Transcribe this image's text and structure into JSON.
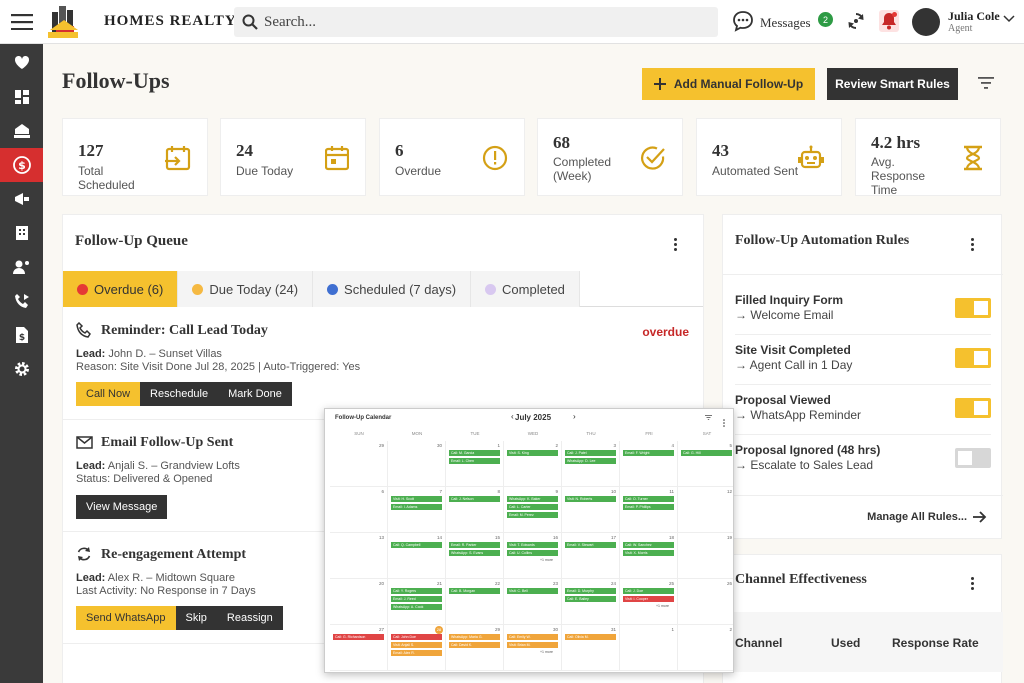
{
  "app": {
    "brand": "HOMES REALTY"
  },
  "search": {
    "placeholder": "Search..."
  },
  "header": {
    "messages_label": "Messages",
    "messages_count": "2",
    "user_name": "Julia Cole",
    "user_role": "Agent"
  },
  "page": {
    "title": "Follow-Ups",
    "add_label": "Add Manual Follow-Up",
    "review_label": "Review Smart Rules"
  },
  "stats": [
    {
      "value": "127",
      "label": "Total Scheduled",
      "icon": "calendar-arrow-icon"
    },
    {
      "value": "24",
      "label": "Due Today",
      "icon": "calendar-icon"
    },
    {
      "value": "6",
      "label": "Overdue",
      "icon": "alert-circle-icon"
    },
    {
      "value": "68",
      "label": "Completed (Week)",
      "icon": "check-circle-icon"
    },
    {
      "value": "43",
      "label": "Automated Sent",
      "icon": "robot-icon"
    },
    {
      "value": "4.2 hrs",
      "label": "Avg. Response Time",
      "icon": "hourglass-icon"
    }
  ],
  "queue": {
    "title": "Follow-Up Queue",
    "tabs": [
      {
        "label": "Overdue (6)",
        "color": "#e53935"
      },
      {
        "label": "Due Today (24)",
        "color": "#f5b942"
      },
      {
        "label": "Scheduled (7 days)",
        "color": "#3f6fd1"
      },
      {
        "label": "Completed",
        "color": "#d8c8f0"
      }
    ],
    "items": [
      {
        "title": "Reminder: Call Lead Today",
        "status": "overdue",
        "line1_key": "Lead:",
        "line1": "John D. – Sunset Villas",
        "line2": "Reason: Site Visit Done Jul 28, 2025 | Auto-Triggered: Yes",
        "buttons": [
          "Call Now",
          "Reschedule",
          "Mark Done"
        ]
      },
      {
        "title": "Email Follow-Up Sent",
        "line1_key": "Lead:",
        "line1": "Anjali S. – Grandview Lofts",
        "line2": "Status: Delivered & Opened",
        "buttons": [
          "View Message"
        ]
      },
      {
        "title": "Re-engagement Attempt",
        "line1_key": "Lead:",
        "line1": "Alex R. – Midtown Square",
        "line2": "Last Activity: No Response in 7 Days",
        "buttons": [
          "Send WhatsApp",
          "Skip",
          "Reassign"
        ]
      }
    ]
  },
  "rules": {
    "title": "Follow-Up Automation Rules",
    "items": [
      {
        "trigger": "Filled Inquiry Form",
        "action": "→ Welcome Email",
        "on": true
      },
      {
        "trigger": "Site Visit Completed",
        "action": "→ Agent Call in 1 Day",
        "on": true
      },
      {
        "trigger": "Proposal Viewed",
        "action": "→ WhatsApp Reminder",
        "on": true
      },
      {
        "trigger": "Proposal Ignored (48 hrs)",
        "action": "→ Escalate to Sales Lead",
        "on": false
      }
    ],
    "manage_label": "Manage All Rules..."
  },
  "channel": {
    "title": "Channel Effectiveness",
    "cols": [
      "Channel",
      "Used",
      "Response Rate"
    ]
  },
  "calendar": {
    "title": "Follow-Up Calendar",
    "month": "July 2025",
    "dows": [
      "SUN",
      "MON",
      "TUE",
      "WED",
      "THU",
      "FRI",
      "SAT"
    ],
    "weeks": [
      [
        {
          "d": "29",
          "ev": []
        },
        {
          "d": "30",
          "ev": []
        },
        {
          "d": "1",
          "ev": [
            [
              "g",
              "Call: M. Garcia"
            ],
            [
              "g",
              "Email: L. Chen"
            ]
          ]
        },
        {
          "d": "2",
          "ev": [
            [
              "g",
              "Visit: S. King"
            ]
          ]
        },
        {
          "d": "3",
          "ev": [
            [
              "g",
              "Call: J. Patel"
            ],
            [
              "g",
              "WhatsApp: D. Lee"
            ]
          ]
        },
        {
          "d": "4",
          "ev": [
            [
              "g",
              "Email: F. Wright"
            ]
          ]
        },
        {
          "d": "5",
          "ev": [
            [
              "g",
              "Call: G. Hill"
            ]
          ]
        }
      ],
      [
        {
          "d": "6",
          "ev": []
        },
        {
          "d": "7",
          "ev": [
            [
              "g",
              "Visit: H. Scott"
            ],
            [
              "g",
              "Email: I. Adams"
            ]
          ]
        },
        {
          "d": "8",
          "ev": [
            [
              "g",
              "Call: J. Nelson"
            ]
          ]
        },
        {
          "d": "9",
          "ev": [
            [
              "g",
              "WhatsApp: K. Baker"
            ],
            [
              "g",
              "Call: L. Carter"
            ],
            [
              "g",
              "Email: M. Perez"
            ]
          ]
        },
        {
          "d": "10",
          "ev": [
            [
              "g",
              "Visit: N. Roberts"
            ]
          ]
        },
        {
          "d": "11",
          "ev": [
            [
              "g",
              "Call: O. Turner"
            ],
            [
              "g",
              "Email: P. Phillips"
            ]
          ]
        },
        {
          "d": "12",
          "ev": []
        }
      ],
      [
        {
          "d": "13",
          "ev": []
        },
        {
          "d": "14",
          "ev": [
            [
              "g",
              "Call: Q. Campbell"
            ]
          ]
        },
        {
          "d": "15",
          "ev": [
            [
              "g",
              "Email: R. Parker"
            ],
            [
              "g",
              "WhatsApp: S. Evans"
            ]
          ]
        },
        {
          "d": "16",
          "ev": [
            [
              "g",
              "Visit: T. Edwards"
            ],
            [
              "g",
              "Call: U. Collins"
            ]
          ],
          "more": "+1 more"
        },
        {
          "d": "17",
          "ev": [
            [
              "g",
              "Email: V. Stewart"
            ]
          ]
        },
        {
          "d": "18",
          "ev": [
            [
              "g",
              "Call: W. Sanchez"
            ],
            [
              "g",
              "Visit: X. Morris"
            ]
          ]
        },
        {
          "d": "19",
          "ev": []
        }
      ],
      [
        {
          "d": "20",
          "ev": []
        },
        {
          "d": "21",
          "ev": [
            [
              "g",
              "Call: Y. Rogers"
            ],
            [
              "g",
              "Email: J. Reed"
            ],
            [
              "g",
              "WhatsApp: A. Cook"
            ]
          ]
        },
        {
          "d": "22",
          "ev": [
            [
              "g",
              "Call: B. Morgan"
            ]
          ]
        },
        {
          "d": "23",
          "ev": [
            [
              "g",
              "Visit: C. Bell"
            ]
          ]
        },
        {
          "d": "24",
          "ev": [
            [
              "g",
              "Email: D. Murphy"
            ],
            [
              "g",
              "Call: E. Bailey"
            ]
          ]
        },
        {
          "d": "25",
          "ev": [
            [
              "g",
              "Call: J. Doe"
            ],
            [
              "r",
              "Visit: I. Cooper"
            ]
          ],
          "more": "+1 more"
        },
        {
          "d": "26",
          "ev": []
        }
      ],
      [
        {
          "d": "27",
          "ev": [
            [
              "r",
              "Call: G. Richardson"
            ]
          ]
        },
        {
          "d": "28",
          "today": true,
          "ev": [
            [
              "r",
              "Call: John Doe"
            ],
            [
              "o",
              "Visit: Anjali S."
            ],
            [
              "o",
              "Email: Alex R."
            ]
          ]
        },
        {
          "d": "29",
          "ev": [
            [
              "o",
              "WhatsApp: Maria G."
            ],
            [
              "o",
              "Call: David K."
            ]
          ]
        },
        {
          "d": "30",
          "ev": [
            [
              "o",
              "Call: Emily W."
            ],
            [
              "o",
              "Visit: Brian M."
            ]
          ],
          "more": "+1 more"
        },
        {
          "d": "31",
          "ev": [
            [
              "o",
              "Call: Olivia M."
            ]
          ]
        },
        {
          "d": "1",
          "ev": []
        },
        {
          "d": "2",
          "ev": []
        }
      ]
    ]
  }
}
